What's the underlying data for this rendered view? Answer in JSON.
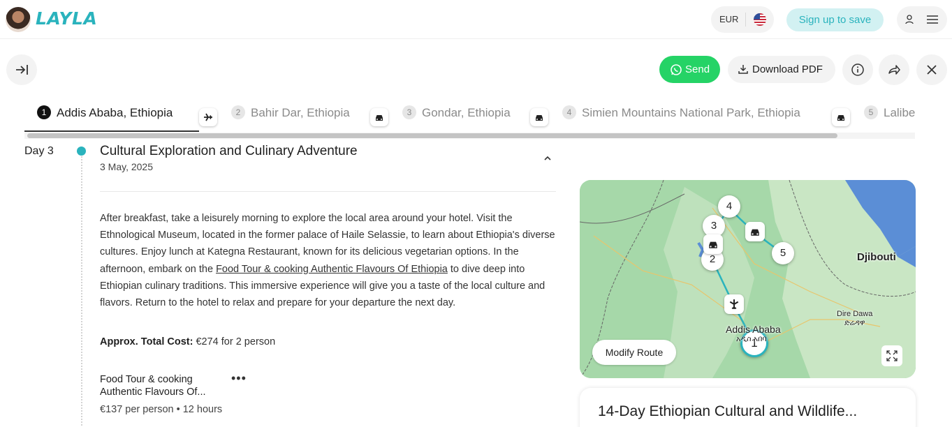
{
  "header": {
    "logo_text": "LAYLA",
    "currency": "EUR",
    "signup_label": "Sign up to save"
  },
  "toolbar": {
    "send_label": "Send",
    "download_label": "Download PDF"
  },
  "tabs": [
    {
      "num": "1",
      "label": "Addis Ababa, Ethiopia",
      "active": true
    },
    {
      "num": "2",
      "label": "Bahir Dar, Ethiopia",
      "active": false
    },
    {
      "num": "3",
      "label": "Gondar, Ethiopia",
      "active": false
    },
    {
      "num": "4",
      "label": "Simien Mountains National Park, Ethiopia",
      "active": false
    },
    {
      "num": "5",
      "label": "Lalibe",
      "active": false
    }
  ],
  "transport_icons": [
    "plane-icon",
    "car-icon",
    "car-icon",
    "car-icon"
  ],
  "day": {
    "label": "Day 3",
    "title": "Cultural Exploration and Culinary Adventure",
    "date": "3 May, 2025",
    "desc_part1": "After breakfast, take a leisurely morning to explore the local area around your hotel. Visit the Ethnological Museum, located in the former palace of Haile Selassie, to learn about Ethiopia's diverse cultures. Enjoy lunch at Kategna Restaurant, known for its delicious vegetarian options. In the afternoon, embark on the ",
    "desc_link": "Food Tour & cooking Authentic Flavours Of Ethiopia",
    "desc_part2": " to dive deep into Ethiopian culinary traditions. This immersive experience will give you a taste of the local culture and flavors. Return to the hotel to relax and prepare for your departure the next day.",
    "cost_label": "Approx. Total Cost:",
    "cost_value": " €274 for 2 person"
  },
  "activity": {
    "title": "Food Tour & cooking Authentic Flavours Of...",
    "more": "•••",
    "meta": "€137 per person • 12 hours"
  },
  "map": {
    "pins": [
      "1",
      "2",
      "3",
      "4",
      "5"
    ],
    "labels": {
      "djibouti": "Djibouti",
      "addis": "Addis Ababa",
      "dire_dawa": "Dire Dawa",
      "dire_dawa_amharic": "ድሬዳዋ",
      "addis_amharic": "አዲስ አበባ"
    },
    "modify_label": "Modify Route",
    "colors": {
      "route": "#2ab3bd",
      "land": "#a6d8a9",
      "water": "#5b8ed6"
    }
  },
  "trip_card": {
    "title": "14-Day Ethiopian Cultural and Wildlife..."
  },
  "colors": {
    "accent": "#2ab3bd",
    "whatsapp": "#25d366"
  }
}
